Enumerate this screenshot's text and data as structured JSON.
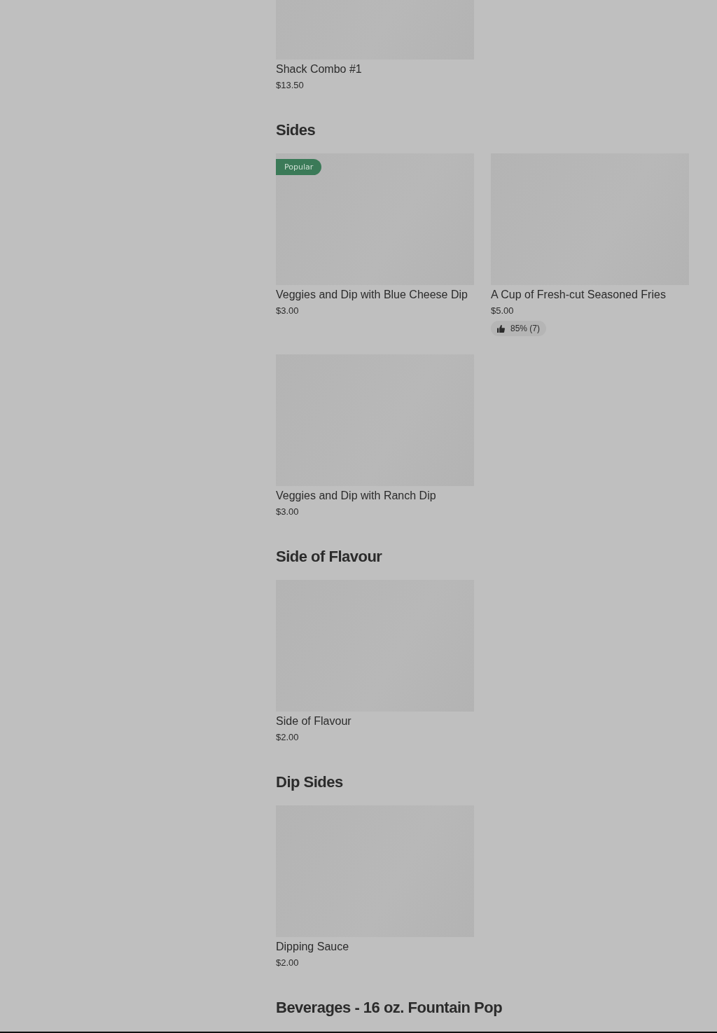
{
  "sections": [
    {
      "items": [
        {
          "name": "Shack Combo #1",
          "price": "$13.50"
        }
      ]
    },
    {
      "title": "Sides",
      "items": [
        {
          "name": "Veggies and Dip with Blue Cheese Dip",
          "price": "$3.00",
          "badge": "Popular"
        },
        {
          "name": "A Cup of Fresh-cut Seasoned Fries",
          "price": "$5.00",
          "rating": "85% (7)"
        },
        {
          "name": "Veggies and Dip with Ranch Dip",
          "price": "$3.00"
        }
      ]
    },
    {
      "title": "Side of Flavour",
      "items": [
        {
          "name": "Side of Flavour",
          "price": "$2.00"
        }
      ]
    },
    {
      "title": "Dip Sides",
      "items": [
        {
          "name": "Dipping Sauce",
          "price": "$2.00"
        }
      ]
    },
    {
      "title": "Beverages - 16 oz. Fountain Pop"
    }
  ]
}
